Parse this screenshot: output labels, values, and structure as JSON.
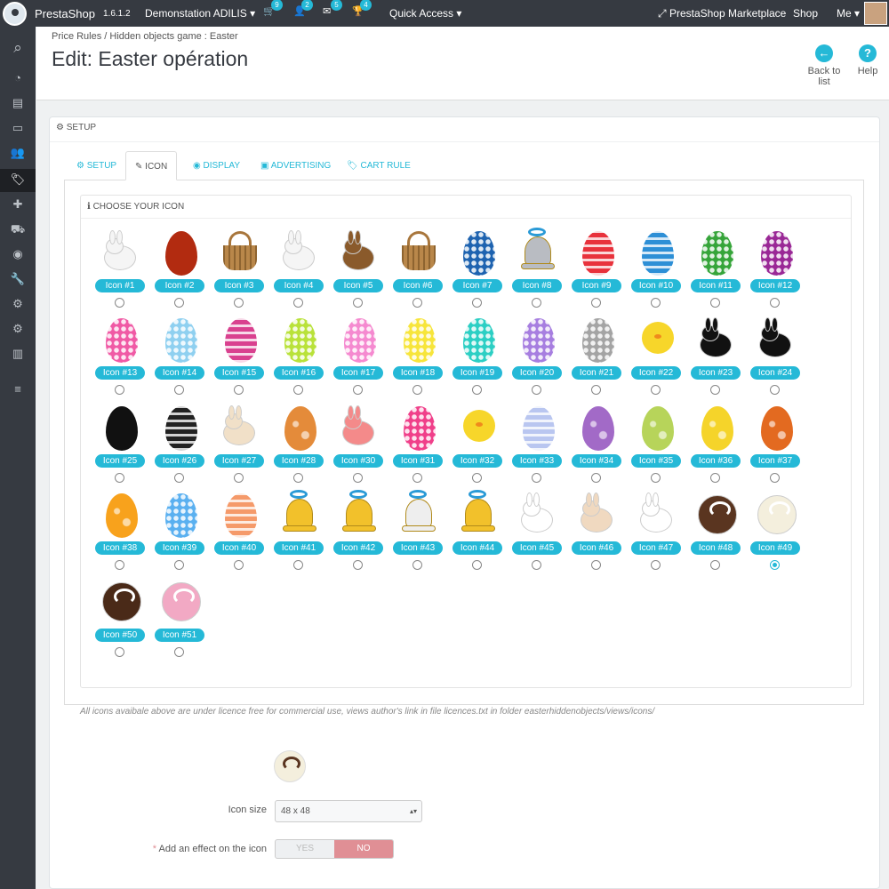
{
  "topbar": {
    "brand": "PrestaShop",
    "version": "1.6.1.2",
    "shop_select": "Demonstation ADILIS",
    "badges": {
      "orders": "9",
      "customers": "2",
      "messages": "5",
      "trophy": "4"
    },
    "quick_access": "Quick Access",
    "marketplace": "PrestaShop Marketplace",
    "shop": "Shop",
    "me": "Me"
  },
  "header": {
    "breadcrumb": "Price Rules  /  Hidden objects game : Easter",
    "title": "Edit: Easter opération",
    "back_label": "Back to list",
    "help_label": "Help"
  },
  "panel": {
    "heading": "SETUP",
    "tabs": [
      "SETUP",
      "ICON",
      "DISPLAY",
      "ADVERTISING",
      "CART RULE"
    ],
    "choose_heading": "CHOOSE YOUR ICON",
    "selected_icon": "Icon #49",
    "icons": [
      "Icon #1",
      "Icon #2",
      "Icon #3",
      "Icon #4",
      "Icon #5",
      "Icon #6",
      "Icon #7",
      "Icon #8",
      "Icon #9",
      "Icon #10",
      "Icon #11",
      "Icon #12",
      "Icon #13",
      "Icon #14",
      "Icon #15",
      "Icon #16",
      "Icon #17",
      "Icon #18",
      "Icon #19",
      "Icon #20",
      "Icon #21",
      "Icon #22",
      "Icon #23",
      "Icon #24",
      "Icon #25",
      "Icon #26",
      "Icon #27",
      "Icon #28",
      "Icon #30",
      "Icon #31",
      "Icon #32",
      "Icon #33",
      "Icon #34",
      "Icon #35",
      "Icon #36",
      "Icon #37",
      "Icon #38",
      "Icon #39",
      "Icon #40",
      "Icon #41",
      "Icon #42",
      "Icon #43",
      "Icon #44",
      "Icon #45",
      "Icon #46",
      "Icon #47",
      "Icon #48",
      "Icon #49",
      "Icon #50",
      "Icon #51"
    ],
    "licence_note": "All icons avaibale above are under licence free for commercial use, views author's link in file licences.txt in folder easterhiddenobjects/views/icons/",
    "icon_size_label": "Icon size",
    "icon_size_value": "48 x 48",
    "effect_label": "Add an effect on the icon",
    "yes": "YES",
    "no": "NO"
  },
  "colors": {
    "accent": "#25b9d7",
    "sidebar": "#363a41",
    "no_toggle": "#e08f95"
  }
}
